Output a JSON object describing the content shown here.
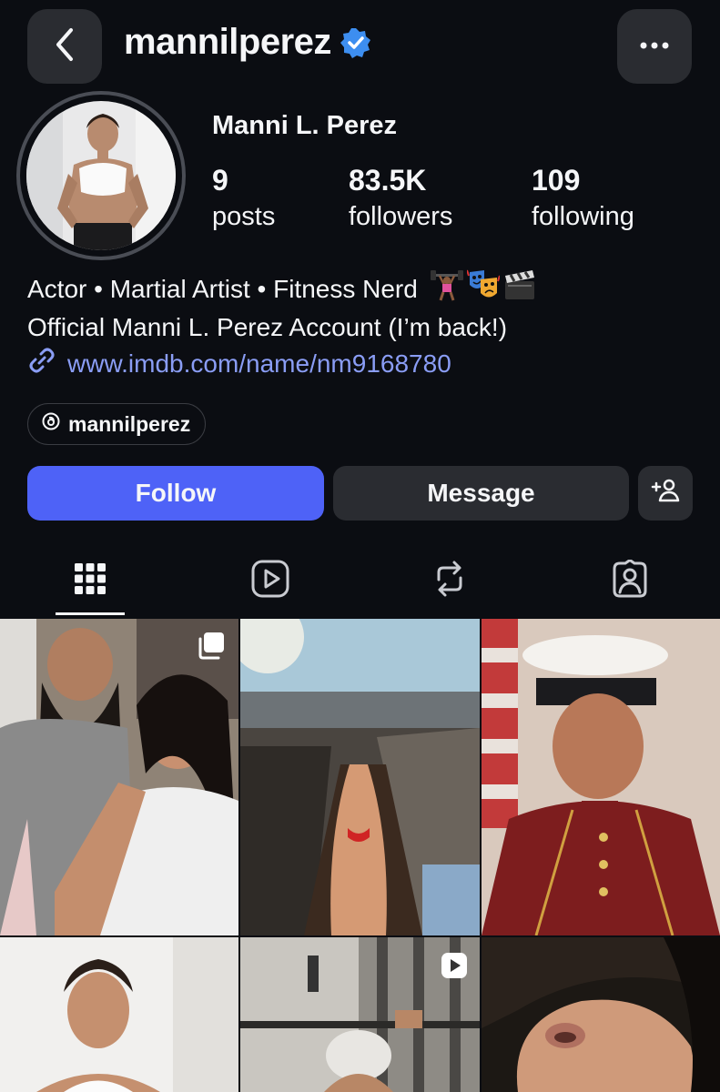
{
  "header": {
    "username": "mannilperez"
  },
  "profile": {
    "display_name": "Manni L. Perez",
    "stats": [
      {
        "value": "9",
        "label": "posts"
      },
      {
        "value": "83.5K",
        "label": "followers"
      },
      {
        "value": "109",
        "label": "following"
      }
    ],
    "bio_line1": "Actor • Martial Artist • Fitness Nerd",
    "bio_line2": "Official Manni L. Perez Account (I’m back!)",
    "link": "www.imdb.com/name/nm9168780",
    "threads_handle": "mannilperez"
  },
  "actions": {
    "follow_label": "Follow",
    "message_label": "Message"
  },
  "colors": {
    "background": "#0b0d12",
    "follow_button": "#4e62f7",
    "secondary_button": "#2a2c31",
    "link": "#8a9df5",
    "verified": "#3d8ef0"
  },
  "tabs": [
    {
      "icon": "grid-icon",
      "active": true
    },
    {
      "icon": "reels-icon",
      "active": false
    },
    {
      "icon": "reposts-icon",
      "active": false
    },
    {
      "icon": "tagged-icon",
      "active": false
    }
  ],
  "grid": [
    {
      "kind": "carousel",
      "subject": "selfie with bearded man"
    },
    {
      "kind": "photo",
      "subject": "sunbathing on rooftop"
    },
    {
      "kind": "photo",
      "subject": "marine dress uniform portrait"
    },
    {
      "kind": "photo",
      "subject": "portrait"
    },
    {
      "kind": "reel",
      "subject": "gym workout"
    },
    {
      "kind": "photo",
      "subject": "close-up face"
    }
  ]
}
